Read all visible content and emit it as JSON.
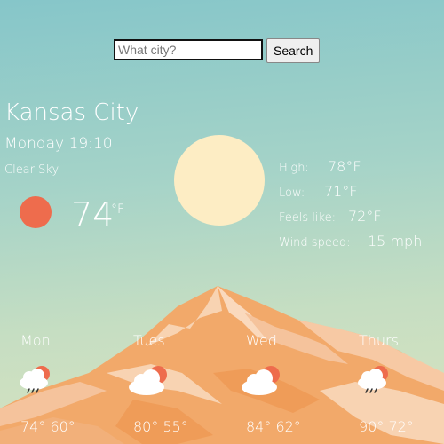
{
  "search": {
    "placeholder": "What city?",
    "value": "",
    "button_label": "Search"
  },
  "current": {
    "city": "Kansas City",
    "datetime": "Monday 19:10",
    "condition": "Clear Sky",
    "temperature": "74",
    "unit": "°F",
    "icon": "sun-icon"
  },
  "stats": {
    "high_label": "High:",
    "high_value": "78°F",
    "low_label": "Low:",
    "low_value": "71°F",
    "feels_label": "Feels like:",
    "feels_value": "72°F",
    "wind_label": "Wind speed:",
    "wind_value": "15 mph"
  },
  "forecast": [
    {
      "day": "Mon",
      "temps": "74° 60°",
      "icon": "rain-cloud-sun-icon"
    },
    {
      "day": "Tues",
      "temps": "80° 55°",
      "icon": "cloud-sun-icon"
    },
    {
      "day": "Wed",
      "temps": "84° 62°",
      "icon": "cloud-sun-icon"
    },
    {
      "day": "Thurs",
      "temps": "90° 72°",
      "icon": "rain-cloud-sun-icon"
    }
  ],
  "colors": {
    "accent_sun": "#ee6c4d",
    "pale_sun": "#fdedc4",
    "mountain_main": "#f2a96a",
    "mountain_light": "#f8d3b2"
  }
}
